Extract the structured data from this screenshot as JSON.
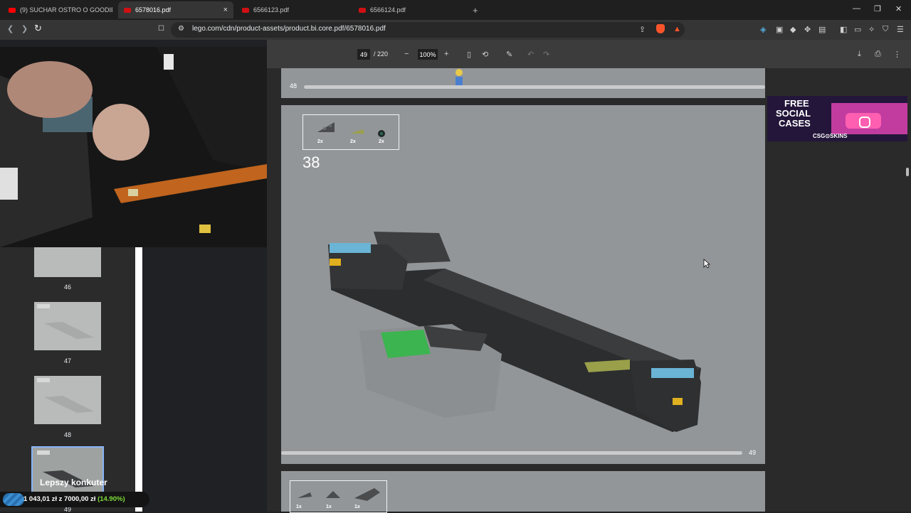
{
  "tabs": [
    {
      "title": "(9) SUCHAR OSTRO O GOODIES! OD",
      "icon": "youtube-icon"
    },
    {
      "title": "6578016.pdf",
      "icon": "lego-icon",
      "close": "×"
    },
    {
      "title": "6566123.pdf",
      "icon": "lego-icon"
    },
    {
      "title": "6566124.pdf",
      "icon": "lego-icon"
    }
  ],
  "new_tab": "+",
  "window": {
    "minimize": "—",
    "restore": "❐",
    "close": "✕"
  },
  "nav": {
    "back": "❮",
    "forward": "❯",
    "reload": "↻",
    "bookmark": "🔖",
    "site_info": "⚙"
  },
  "address": {
    "url": "lego.com/cdn/product-assets/product.bi.core.pdf/6578016.pdf"
  },
  "pdf_toolbar": {
    "page_current": "49",
    "page_total": "/ 220",
    "zoom_out": "−",
    "zoom": "100%",
    "zoom_in": "+",
    "fit_icon": "▯",
    "rotate_icon": "⟲",
    "annotate_icon": "✎",
    "undo": "↶",
    "redo": "↷",
    "download_icon": "⤓",
    "print_icon": "⎙",
    "menu_icon": "⋮"
  },
  "thumbnails": [
    {
      "label": "46"
    },
    {
      "label": "47"
    },
    {
      "label": "48"
    },
    {
      "label": "49"
    }
  ],
  "pages": {
    "prev_page_number": "48",
    "current_page_number": "49",
    "step_number": "38",
    "parts": [
      {
        "qty": "2x"
      },
      {
        "qty": "2x"
      },
      {
        "qty": "2x"
      }
    ],
    "next_parts": [
      {
        "qty": "1x"
      },
      {
        "qty": "1x"
      },
      {
        "qty": "1x"
      }
    ]
  },
  "ad": {
    "line1": "FREE",
    "line2": "SOCIAL",
    "line3": "CASES",
    "brand": "CSG⊙SKINS"
  },
  "stream_overlay": {
    "title": "Lepszy konkuter",
    "goal_current": "1 043,01 zł",
    "goal_sep": "z",
    "goal_target": "7000,00 zł",
    "goal_percent": "(14.90%)"
  },
  "colors": {
    "accent": "#8ab4f8",
    "goal_green": "#7fdc3a",
    "brave_orange": "#fb542b"
  }
}
